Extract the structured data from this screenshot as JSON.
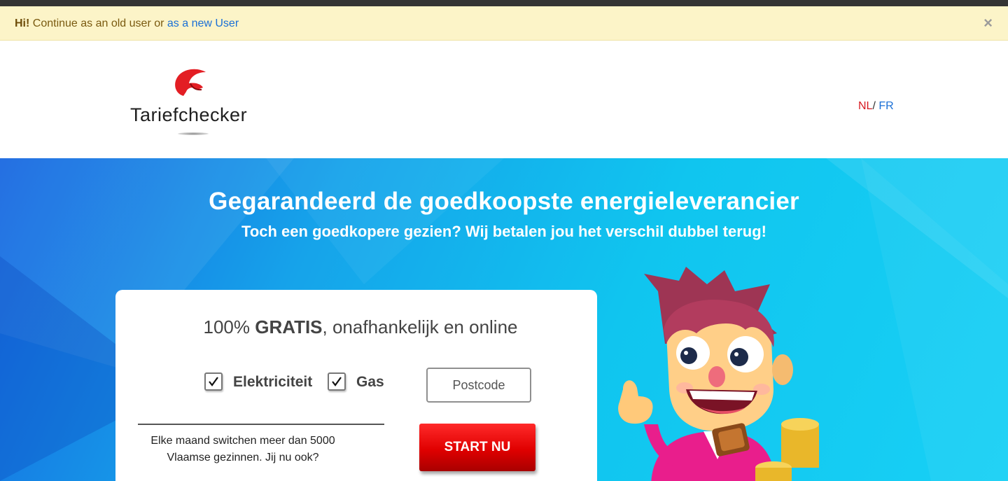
{
  "alert": {
    "greeting": "Hi!",
    "text": " Continue as an old user or ",
    "link": "as a new User",
    "close_glyph": "×"
  },
  "header": {
    "logo_text": "Tariefchecker",
    "lang_nl": "NL",
    "lang_sep": "/ ",
    "lang_fr": "FR"
  },
  "hero": {
    "title": "Gegarandeerd de goedkoopste energieleverancier",
    "subtitle": "Toch een goedkopere gezien? Wij betalen jou het verschil dubbel terug!"
  },
  "card": {
    "title_prefix": "100% ",
    "title_bold": "GRATIS",
    "title_suffix": ", onafhankelijk en online",
    "options": [
      {
        "label": "Elektriciteit",
        "checked": true
      },
      {
        "label": "Gas",
        "checked": true
      }
    ],
    "postcode_placeholder": "Postcode",
    "note_line1": "Elke maand switchen meer dan 5000",
    "note_line2": "Vlaamse gezinnen. Jij nu ook?",
    "start_button": "START NU"
  },
  "colors": {
    "accent_red": "#d71920",
    "link_blue": "#1a6fd6",
    "alert_bg": "#fcf4c8",
    "hero_cyan": "#10c5ef"
  },
  "icons": [
    "close-icon",
    "logo-swoosh-icon",
    "checkmark-icon",
    "mascot-illustration"
  ]
}
